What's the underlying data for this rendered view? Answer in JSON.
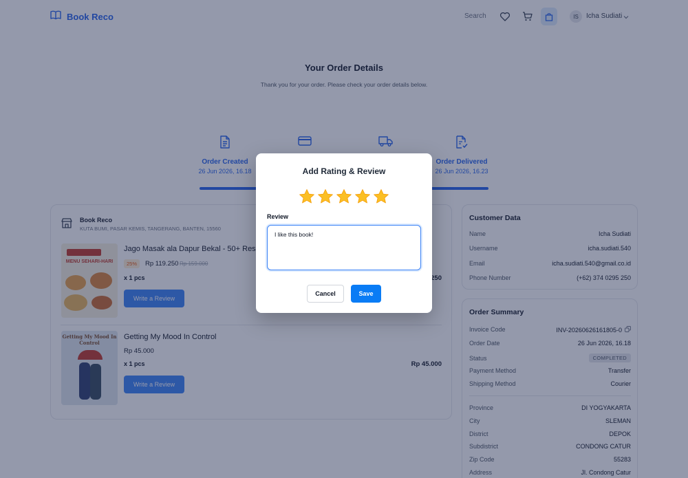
{
  "header": {
    "logo": "Book Reco",
    "search_label": "Search",
    "avatar_initials": "IS",
    "user_name": "Icha Sudiati"
  },
  "page": {
    "title": "Your Order Details",
    "subtitle": "Thank you for your order. Please check your order details below."
  },
  "steps": [
    {
      "label": "Order Created",
      "date": "26 Jun 2026, 16.18",
      "icon": "document-icon"
    },
    {
      "label": "",
      "date": "",
      "icon": "credit-card-icon"
    },
    {
      "label": "",
      "date": "",
      "icon": "truck-icon"
    },
    {
      "label": "Order Delivered",
      "date": "26 Jun 2026, 16.23",
      "icon": "document-check-icon"
    }
  ],
  "shop": {
    "name": "Book Reco",
    "address": "KUTA BUMI, PASAR KEMIS, TANGERANG, BANTEN, 15560"
  },
  "items": [
    {
      "title": "Jago Masak ala Dapur Bekal - 50+ Resep",
      "discount": "25%",
      "price": "Rp 119.250",
      "old_price": "Rp 159.000",
      "qty": "x 1 pcs",
      "total": "250",
      "review_button": "Write a Review",
      "cover_text": "MENU SEHARI-HARI"
    },
    {
      "title": "Getting My Mood In Control",
      "price": "Rp 45.000",
      "qty": "x 1 pcs",
      "total": "Rp 45.000",
      "review_button": "Write a Review",
      "cover_text": "Getting My Mood In Control"
    }
  ],
  "customer": {
    "title": "Customer Data",
    "rows": [
      {
        "k": "Name",
        "v": "Icha Sudiati"
      },
      {
        "k": "Username",
        "v": "icha.sudiati.540"
      },
      {
        "k": "Email",
        "v": "icha.sudiati.540@gmail.co.id"
      },
      {
        "k": "Phone Number",
        "v": "(+62) 374 0295 250"
      }
    ]
  },
  "summary": {
    "title": "Order Summary",
    "invoice_label": "Invoice Code",
    "invoice_value": "INV-20260626161805-0",
    "order_date_label": "Order Date",
    "order_date_value": "26 Jun 2026, 16.18",
    "status_label": "Status",
    "status_value": "COMPLETED",
    "payment_label": "Payment Method",
    "payment_value": "Transfer",
    "shipping_label": "Shipping Method",
    "shipping_value": "Courier",
    "address_rows": [
      {
        "k": "Province",
        "v": "DI YOGYAKARTA"
      },
      {
        "k": "City",
        "v": "SLEMAN"
      },
      {
        "k": "District",
        "v": "DEPOK"
      },
      {
        "k": "Subdistrict",
        "v": "CONDONG CATUR"
      },
      {
        "k": "Zip Code",
        "v": "55283"
      },
      {
        "k": "Address",
        "v": "Jl. Condong Catur"
      }
    ]
  },
  "modal": {
    "title": "Add Rating & Review",
    "rating": 5,
    "rating_max": 5,
    "review_label": "Review",
    "review_value": "I like this book!",
    "cancel_label": "Cancel",
    "save_label": "Save"
  },
  "colors": {
    "brand": "#2563eb",
    "save": "#0a7cf5",
    "star": "#fbbf24",
    "overlay": "#1f2950"
  }
}
